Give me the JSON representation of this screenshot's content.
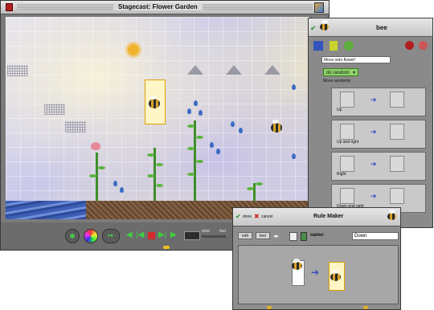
{
  "main_window": {
    "title": "Stagecast: Flower Garden",
    "speed_slow": "slow",
    "speed_fast": "fast"
  },
  "bee_panel": {
    "name": "bee",
    "rule_comment": "Move onto flower!",
    "do_random": "do random",
    "group_label": "Move randomly",
    "rules": [
      {
        "label": "Up"
      },
      {
        "label": "Up and right"
      },
      {
        "label": "Right"
      },
      {
        "label": "Down and right"
      }
    ]
  },
  "rule_maker": {
    "title": "Rule Maker",
    "done": "done",
    "cancel": "cancel",
    "edit": "edit",
    "test": "test",
    "name_label": "name:",
    "name_value": "Down"
  },
  "colors": {
    "go_green": "#3fcf3f",
    "stop_red": "#d12b2b",
    "accent_yellow": "#e0a000"
  }
}
